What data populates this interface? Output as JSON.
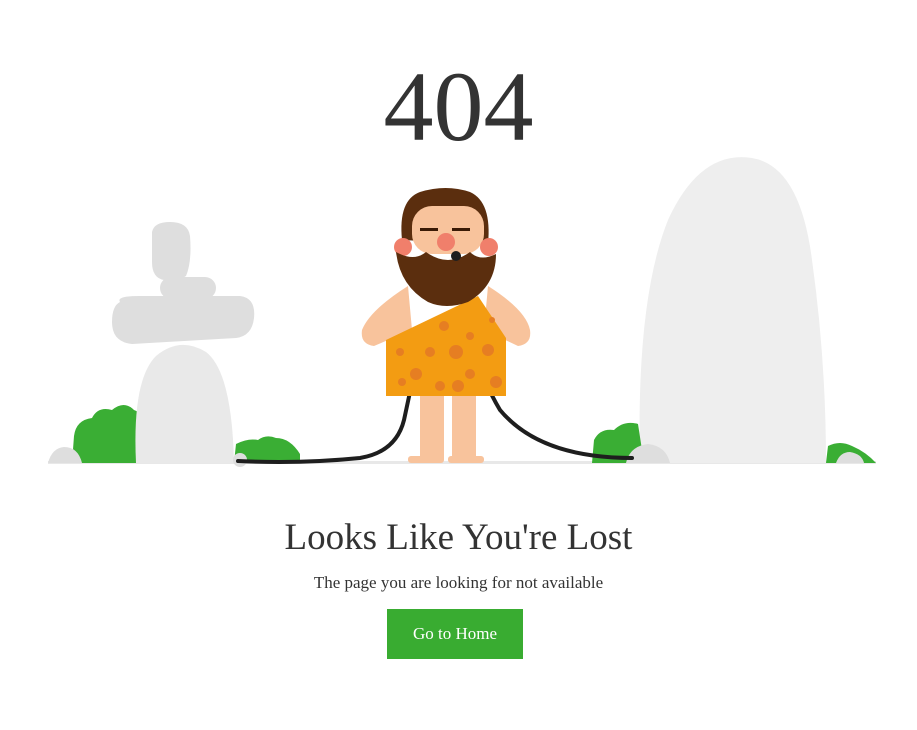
{
  "error": {
    "code": "404",
    "title": "Looks Like You're Lost",
    "message": "The page you are looking for not available"
  },
  "actions": {
    "home_label": "Go to Home"
  },
  "colors": {
    "accent": "#39ac31",
    "text": "#333333",
    "rock": "#dedede",
    "bush": "#3aae34",
    "tunic": "#f39c12",
    "tunic_spots": "#e67e22",
    "skin": "#f8c39c",
    "beard": "#5b2e0e"
  }
}
